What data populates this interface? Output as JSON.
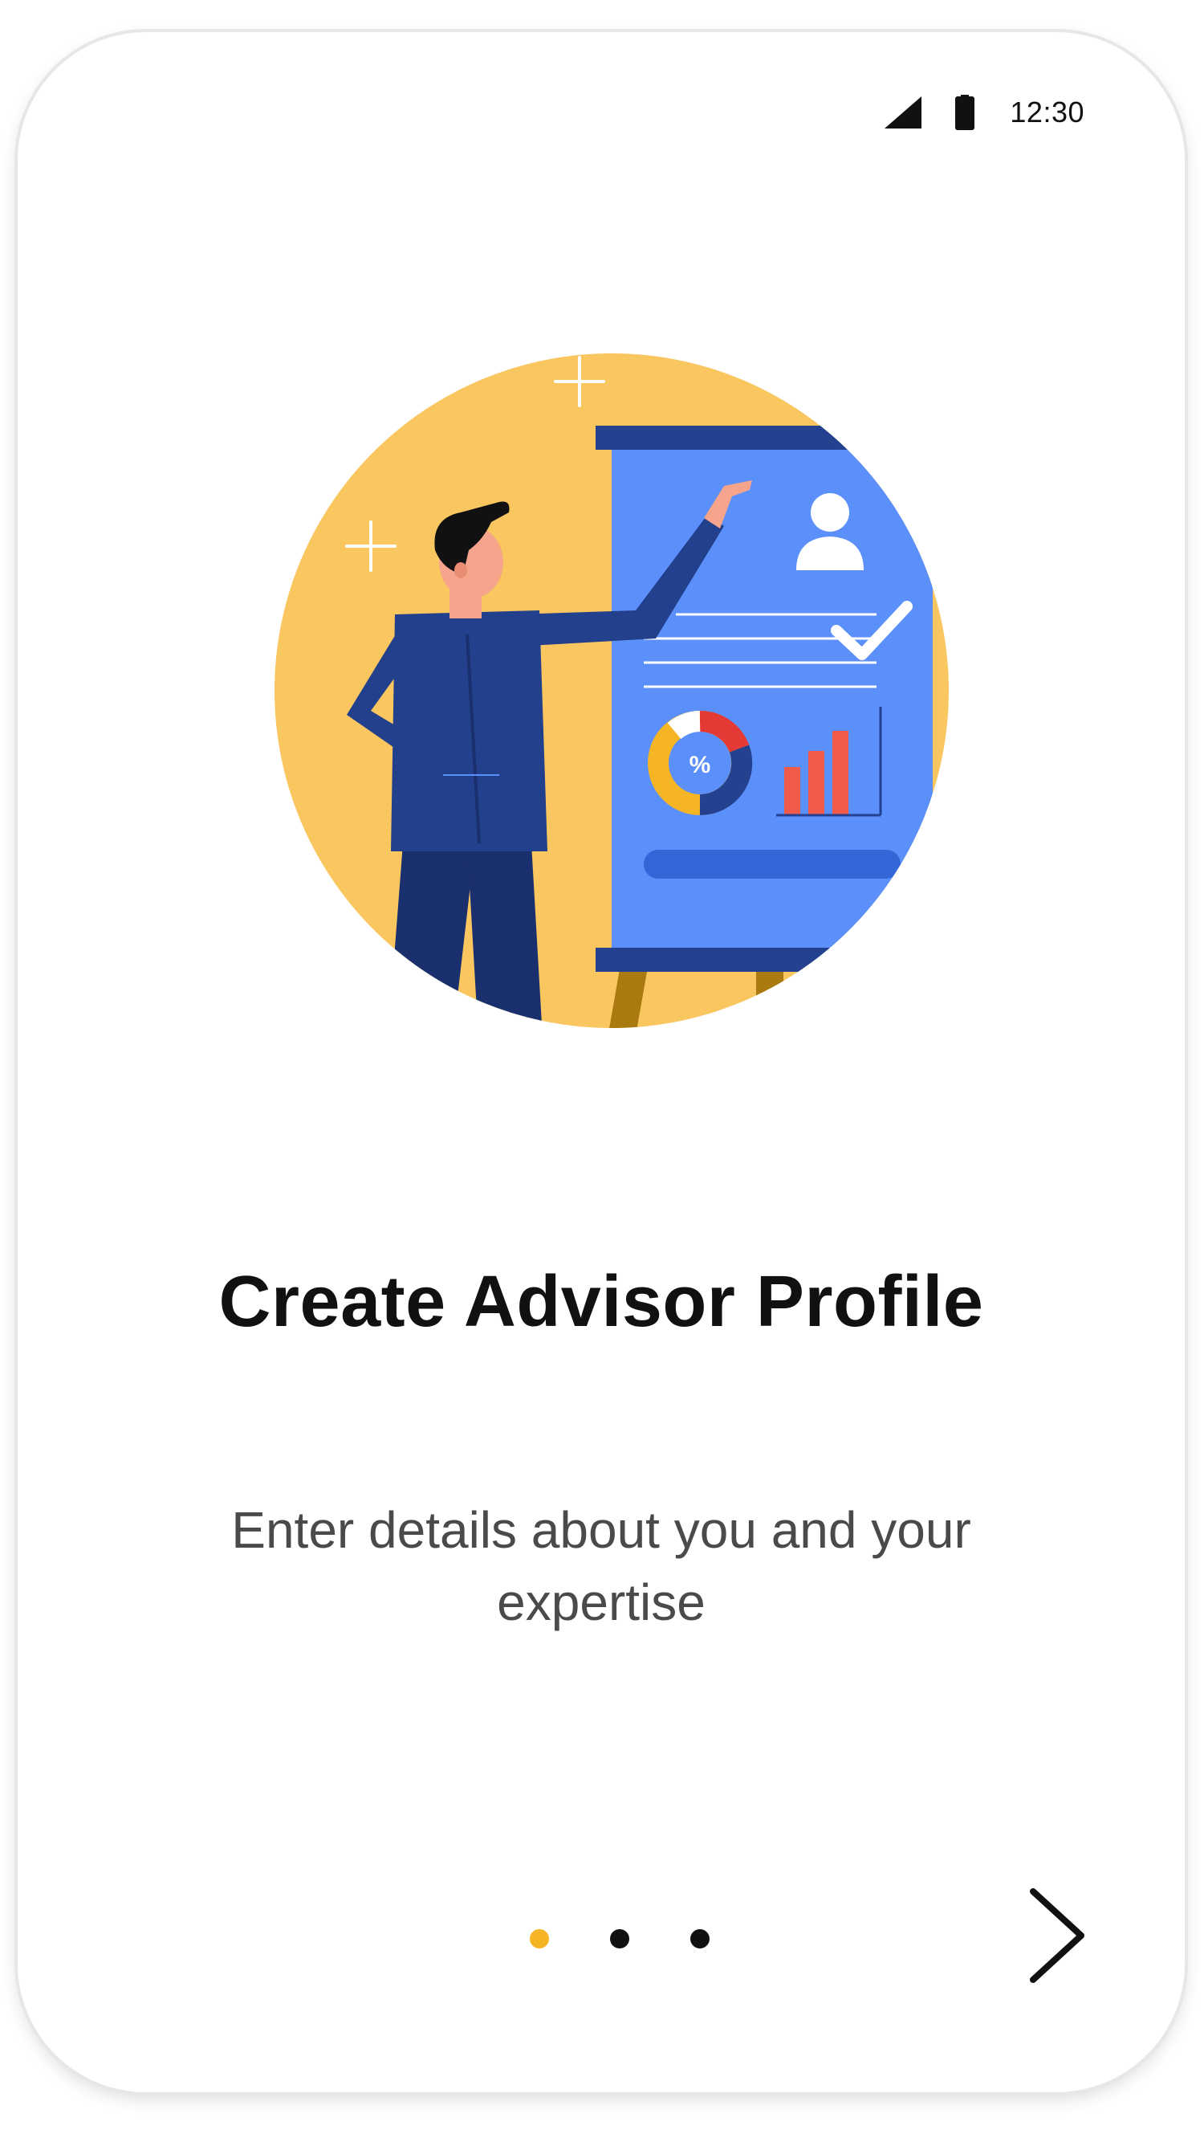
{
  "status_bar": {
    "time": "12:30",
    "icons": [
      "signal-icon",
      "battery-icon"
    ]
  },
  "onboarding": {
    "illustration": "advisor-presenting-board-illustration",
    "title": "Create Advisor Profile",
    "subtitle": "Enter details about you and your expertise",
    "pager": {
      "total_pages": 3,
      "active_index": 0
    },
    "next_icon": "chevron-right-icon"
  },
  "colors": {
    "accent": "#f5b525",
    "circle_bg": "#f9c660",
    "board_blue": "#5b8ff9",
    "suit_navy": "#1f3a87",
    "text_primary": "#111111",
    "text_secondary": "#4a4a4a"
  }
}
